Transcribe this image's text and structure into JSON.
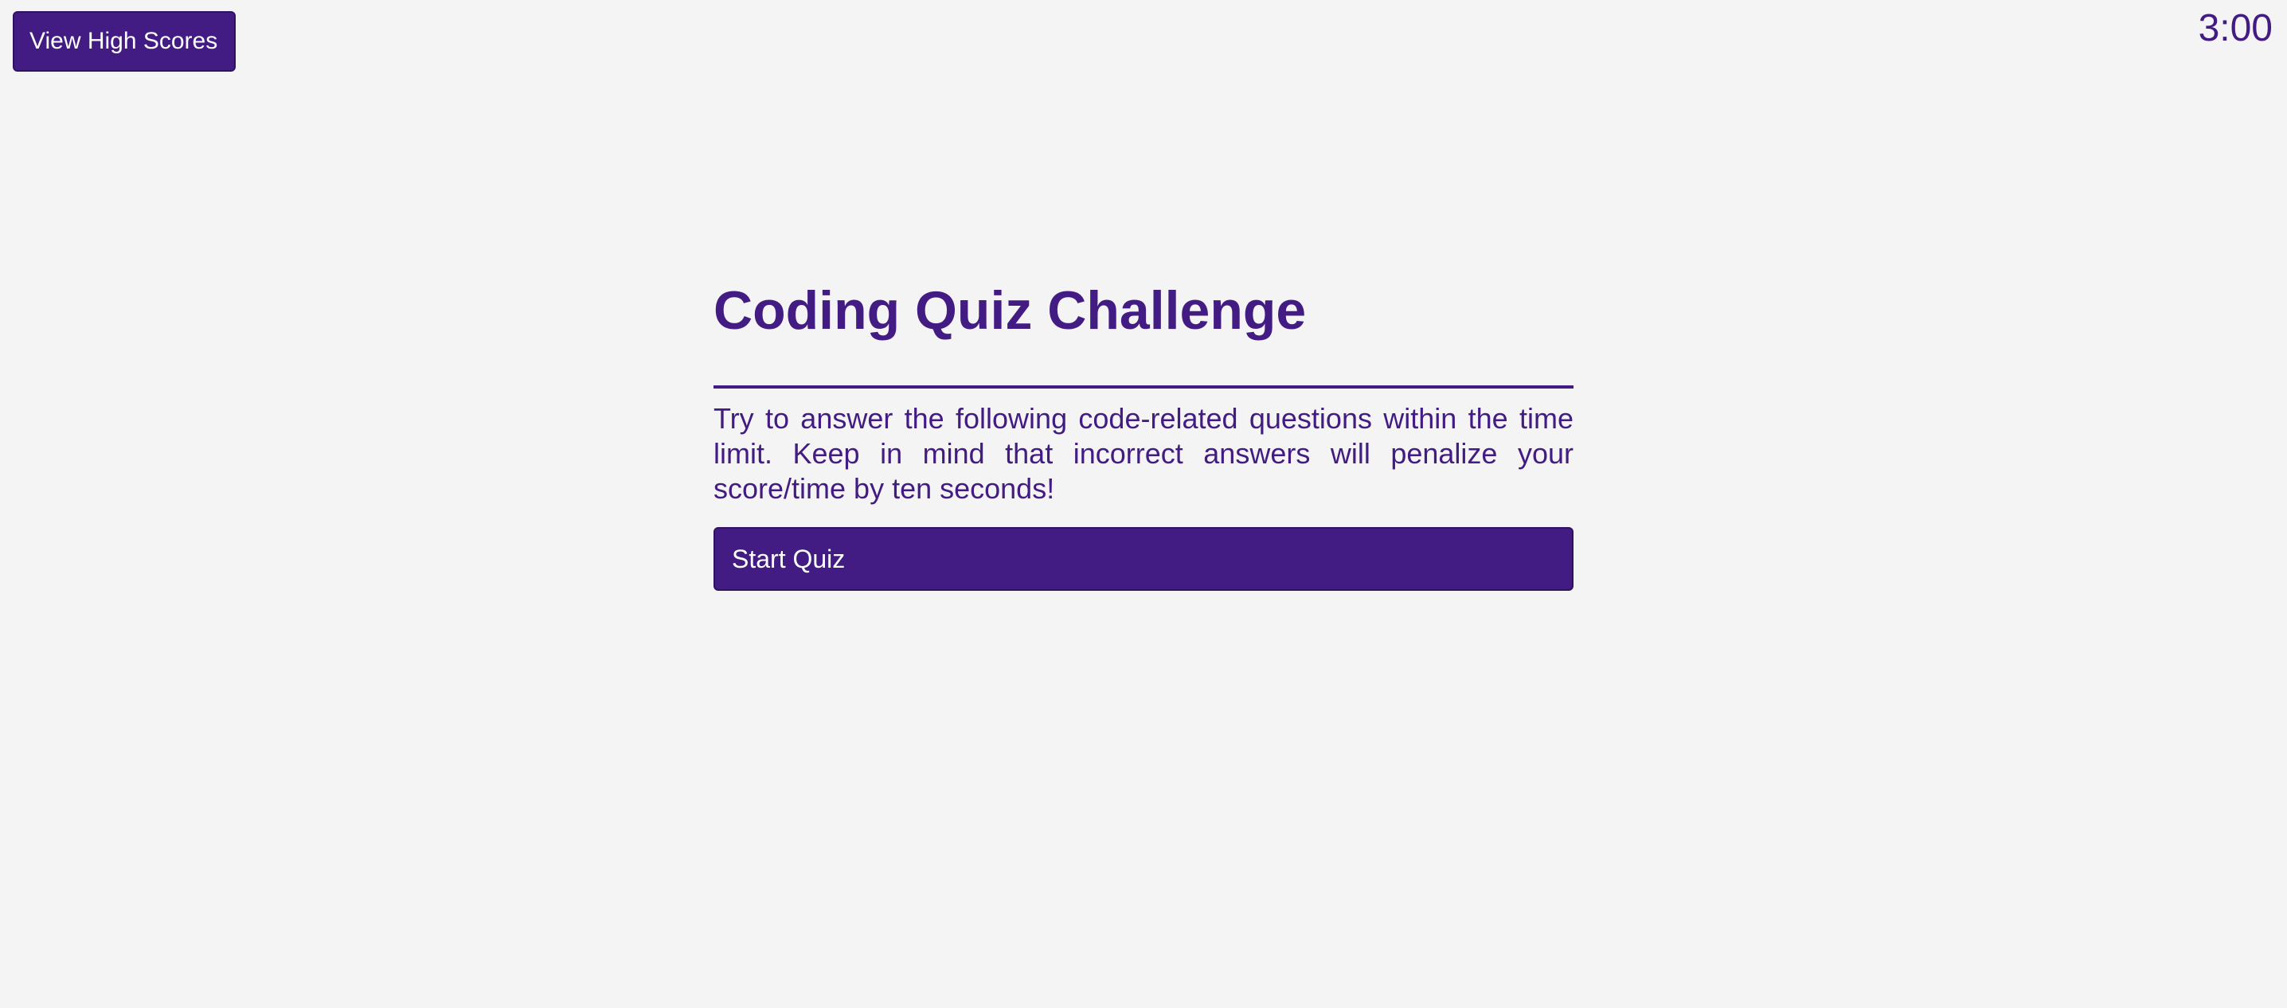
{
  "header": {
    "high_scores_label": "View High Scores",
    "timer": "3:00"
  },
  "quiz": {
    "title": "Coding Quiz Challenge",
    "description": "Try to answer the following code-related questions within the time limit. Keep in mind that incorrect answers will penalize your score/time by ten seconds!",
    "start_label": "Start Quiz"
  },
  "colors": {
    "primary": "#421c82",
    "background": "#f4f4f5",
    "button_text": "#ffffff"
  }
}
